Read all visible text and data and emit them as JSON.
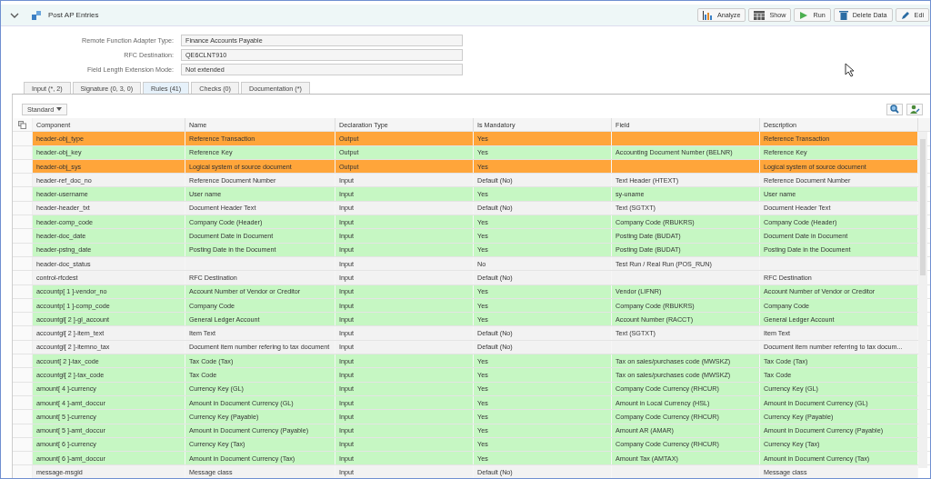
{
  "header": {
    "title": "Post AP Entries",
    "expanded": true,
    "buttons": [
      {
        "label": "Analyze",
        "kind": "chart"
      },
      {
        "label": "Show",
        "kind": "table"
      },
      {
        "label": "Run",
        "kind": "play"
      },
      {
        "label": "Delete Data",
        "kind": "trash"
      },
      {
        "label": "Edi",
        "kind": "pencil"
      }
    ]
  },
  "form": [
    {
      "label": "Remote Function Adapter Type:",
      "value": "Finance Accounts Payable"
    },
    {
      "label": "RFC Destination:",
      "value": "QE6CLNT910"
    },
    {
      "label": "Field Length Extension Mode:",
      "value": "Not extended"
    }
  ],
  "tabs": [
    {
      "label": "Input (*, 2)",
      "selected": false
    },
    {
      "label": "Signature (0, 3, 0)",
      "selected": false
    },
    {
      "label": "Rules (41)",
      "selected": true
    },
    {
      "label": "Checks (0)",
      "selected": false
    },
    {
      "label": "Documentation (*)",
      "selected": false
    }
  ],
  "variant": "Standard",
  "table": {
    "columns": [
      "Component",
      "Name",
      "Declaration Type",
      "Is Mandatory",
      "Field",
      "Description"
    ],
    "rows": [
      {
        "color": "#ffa53a",
        "cells": [
          "header-obj_type",
          "Reference Transaction",
          "Output",
          "Yes",
          "",
          "Reference Transaction"
        ]
      },
      {
        "color": "#c6f7c3",
        "cells": [
          "header-obj_key",
          "Reference Key",
          "Output",
          "Yes",
          "Accounting Document Number (BELNR)",
          "Reference Key"
        ]
      },
      {
        "color": "#ffa53a",
        "cells": [
          "header-obj_sys",
          "Logical system of source document",
          "Output",
          "Yes",
          "",
          "Logical system of source document"
        ]
      },
      {
        "color": "#f2f2f2",
        "cells": [
          "header-ref_doc_no",
          "Reference Document Number",
          "Input",
          "Default (No)",
          "Text Header (HTEXT)",
          "Reference Document Number"
        ]
      },
      {
        "color": "#c6f7c3",
        "cells": [
          "header-username",
          "User name",
          "Input",
          "Yes",
          "sy-uname",
          "User name"
        ]
      },
      {
        "color": "#f2f2f2",
        "cells": [
          "header-header_txt",
          "Document Header Text",
          "Input",
          "Default (No)",
          "Text (SGTXT)",
          "Document Header Text"
        ]
      },
      {
        "color": "#c6f7c3",
        "cells": [
          "header-comp_code",
          "Company Code (Header)",
          "Input",
          "Yes",
          "Company Code (RBUKRS)",
          "Company Code (Header)"
        ]
      },
      {
        "color": "#c6f7c3",
        "cells": [
          "header-doc_date",
          "Document Date in Document",
          "Input",
          "Yes",
          "Posting Date (BUDAT)",
          "Document Date in Document"
        ]
      },
      {
        "color": "#c6f7c3",
        "cells": [
          "header-pstng_date",
          "Posting Date in the Document",
          "Input",
          "Yes",
          "Posting Date (BUDAT)",
          "Posting Date in the Document"
        ]
      },
      {
        "color": "#f2f2f2",
        "cells": [
          "header-doc_status",
          "",
          "Input",
          "No",
          "Test Run / Real Run (POS_RUN)",
          ""
        ]
      },
      {
        "color": "#f2f2f2",
        "cells": [
          "control-rfcdest",
          "RFC Destination",
          "Input",
          "Default (No)",
          "",
          "RFC Destination"
        ]
      },
      {
        "color": "#c6f7c3",
        "cells": [
          "accountp[ 1 ]-vendor_no",
          "Account Number of Vendor or Creditor",
          "Input",
          "Yes",
          "Vendor (LIFNR)",
          "Account Number of Vendor or Creditor"
        ]
      },
      {
        "color": "#c6f7c3",
        "cells": [
          "accountp[ 1 ]-comp_code",
          "Company Code",
          "Input",
          "Yes",
          "Company Code (RBUKRS)",
          "Company Code"
        ]
      },
      {
        "color": "#c6f7c3",
        "cells": [
          "accountgl[ 2 ]-gl_account",
          "General Ledger Account",
          "Input",
          "Yes",
          "Account Number (RACCT)",
          "General Ledger Account"
        ]
      },
      {
        "color": "#f2f2f2",
        "cells": [
          "accountgl[ 2 ]-item_text",
          "Item Text",
          "Input",
          "Default (No)",
          "Text (SGTXT)",
          "Item Text"
        ]
      },
      {
        "color": "#f2f2f2",
        "cells": [
          "accountgl[ 2 ]-itemno_tax",
          "Document item number refering to tax document",
          "Input",
          "Default (No)",
          "",
          "Document item number referring to tax docum..."
        ]
      },
      {
        "color": "#c6f7c3",
        "cells": [
          "account[ 2 ]-tax_code",
          "Tax Code (Tax)",
          "Input",
          "Yes",
          "Tax on sales/purchases code (MWSKZ)",
          "Tax Code (Tax)"
        ]
      },
      {
        "color": "#c6f7c3",
        "cells": [
          "accountgl[ 2 ]-tax_code",
          "Tax Code",
          "Input",
          "Yes",
          "Tax on sales/purchases code (MWSKZ)",
          "Tax Code"
        ]
      },
      {
        "color": "#c6f7c3",
        "cells": [
          "amount[ 4 ]-currency",
          "Currency Key (GL)",
          "Input",
          "Yes",
          "Company Code Currency (RHCUR)",
          "Currency Key (GL)"
        ]
      },
      {
        "color": "#c6f7c3",
        "cells": [
          "amount[ 4 ]-amt_doccur",
          "Amount in Document Currency (GL)",
          "Input",
          "Yes",
          "Amount in Local Currency (HSL)",
          "Amount in Document Currency (GL)"
        ]
      },
      {
        "color": "#c6f7c3",
        "cells": [
          "amount[ 5 ]-currency",
          "Currency Key (Payable)",
          "Input",
          "Yes",
          "Company Code Currency (RHCUR)",
          "Currency Key (Payable)"
        ]
      },
      {
        "color": "#c6f7c3",
        "cells": [
          "amount[ 5 ]-amt_doccur",
          "Amount in Document Currency (Payable)",
          "Input",
          "Yes",
          "Amount AR (AMAR)",
          "Amount in Document Currency (Payable)"
        ]
      },
      {
        "color": "#c6f7c3",
        "cells": [
          "amount[ 6 ]-currency",
          "Currency Key (Tax)",
          "Input",
          "Yes",
          "Company Code Currency (RHCUR)",
          "Currency Key (Tax)"
        ]
      },
      {
        "color": "#c6f7c3",
        "cells": [
          "amount[ 6 ]-amt_doccur",
          "Amount in Document Currency (Tax)",
          "Input",
          "Yes",
          "Amount Tax (AMTAX)",
          "Amount in Document Currency (Tax)"
        ]
      },
      {
        "color": "#f2f2f2",
        "cells": [
          "message-msgid",
          "Message class",
          "Input",
          "Default (No)",
          "",
          "Message class"
        ]
      }
    ]
  }
}
